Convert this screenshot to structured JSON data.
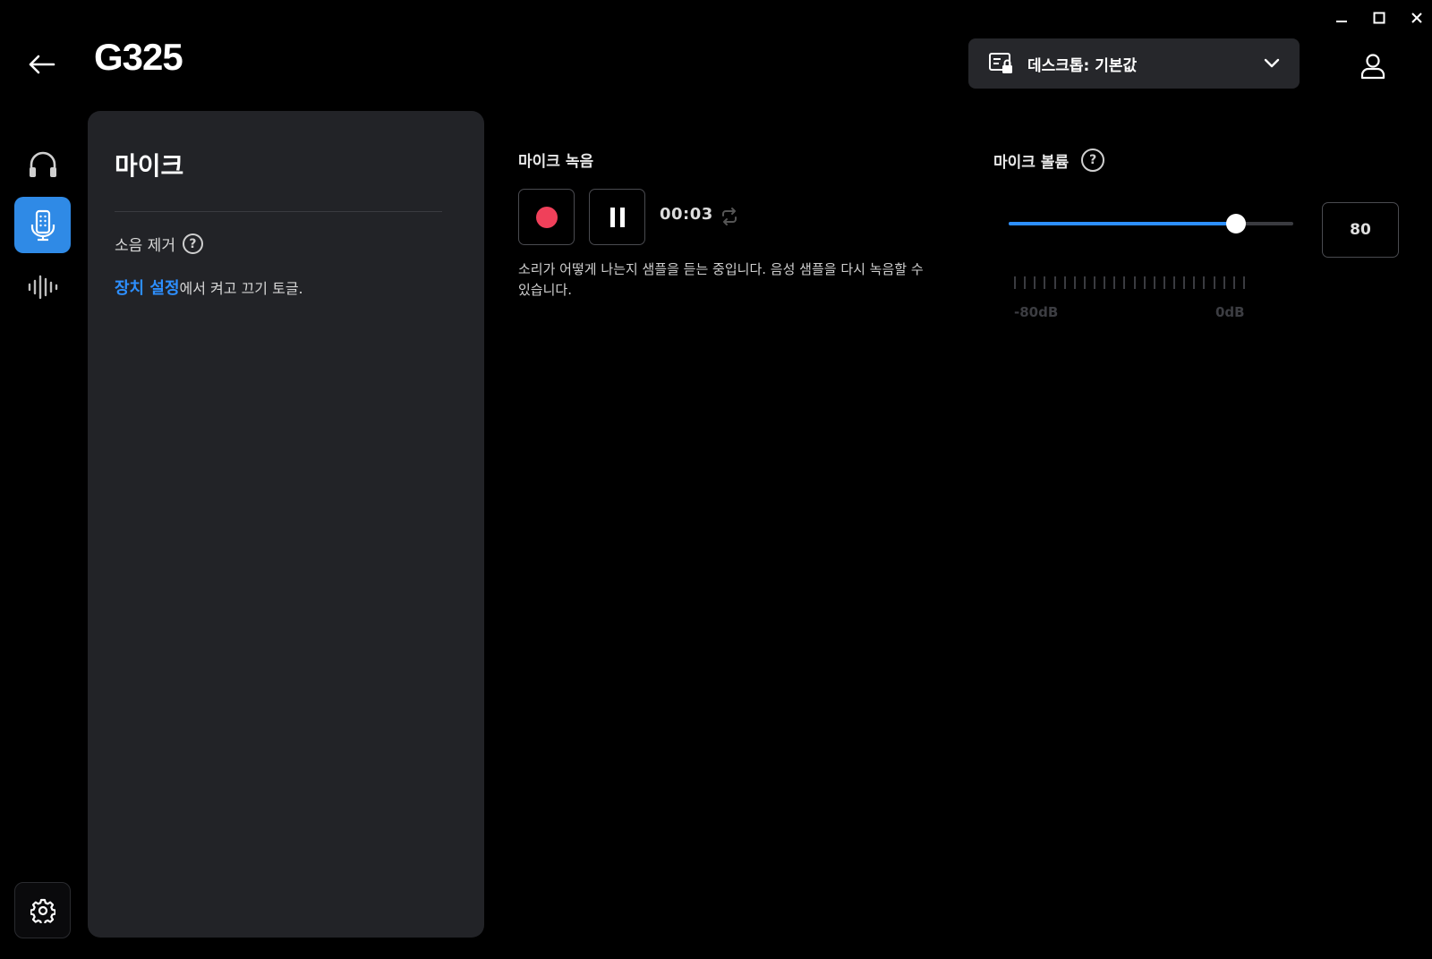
{
  "window": {
    "minimize_icon": "minimize-icon",
    "maximize_icon": "maximize-icon",
    "close_icon": "close-icon"
  },
  "header": {
    "device_name": "G325",
    "profile_label": "데스크톱: 기본값",
    "back_icon": "arrow-left-icon",
    "user_icon": "user-icon"
  },
  "nav": {
    "items": [
      {
        "icon": "headphones-icon",
        "active": false
      },
      {
        "icon": "microphone-icon",
        "active": true
      },
      {
        "icon": "equalizer-icon",
        "active": false
      }
    ],
    "settings_icon": "gear-icon"
  },
  "panel": {
    "title": "마이크",
    "noise_cancel_label": "소음 제거",
    "help_glyph": "?",
    "desc_link": "장치 설정",
    "desc_rest": "에서 켜고 끄기 토글."
  },
  "recording": {
    "title": "마이크 녹음",
    "time": "00:03",
    "description": "소리가 어떻게 나는지 샘플을 듣는 중입니다. 음성 샘플을 다시 녹음할 수 있습니다."
  },
  "volume": {
    "title": "마이크 볼륨",
    "help_glyph": "?",
    "value": "80",
    "slider_fraction": 0.8,
    "meter_min": "-80dB",
    "meter_max": "0dB"
  },
  "colors": {
    "accent": "#2d8fff",
    "record": "#f0405a",
    "panel": "#222327"
  }
}
